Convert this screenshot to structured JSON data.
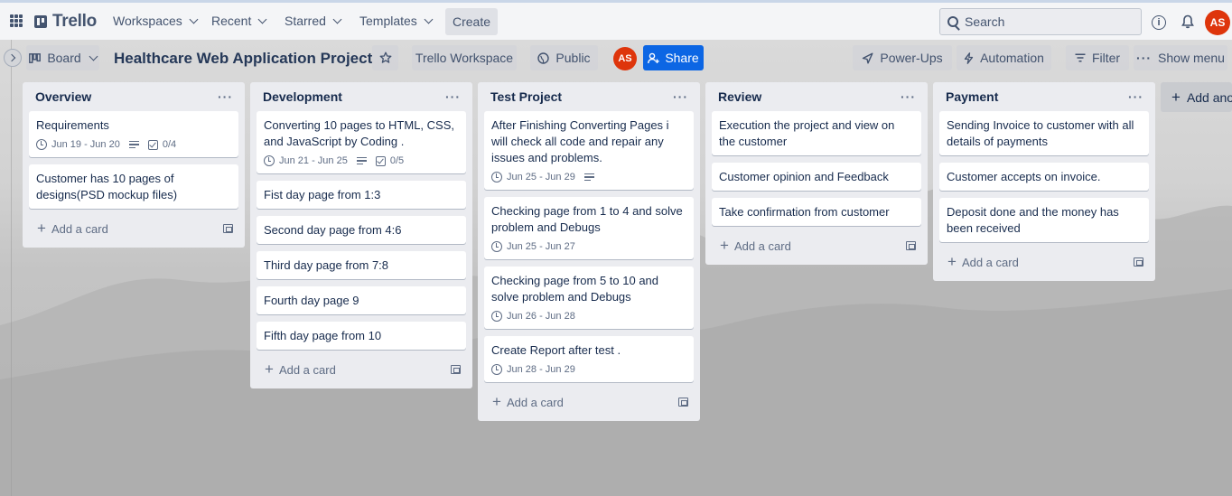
{
  "topbar": {
    "logo": "Trello",
    "nav": [
      {
        "label": "Workspaces"
      },
      {
        "label": "Recent"
      },
      {
        "label": "Starred"
      },
      {
        "label": "Templates"
      }
    ],
    "create": "Create",
    "search_placeholder": "Search",
    "avatar": "AS"
  },
  "board": {
    "view": "Board",
    "title": "Healthcare Web Application Project",
    "workspace": "Trello Workspace",
    "visibility": "Public",
    "member": "AS",
    "share": "Share",
    "powerups": "Power-Ups",
    "automation": "Automation",
    "filter": "Filter",
    "show_menu": "Show menu",
    "add_list": "Add another list"
  },
  "add_card_label": "Add a card",
  "lists": [
    {
      "title": "Overview",
      "cards": [
        {
          "title": "Requirements",
          "date": "Jun 19 - Jun 20",
          "desc": true,
          "checklist": "0/4"
        },
        {
          "title": "Customer has 10 pages of designs(PSD mockup files)"
        }
      ]
    },
    {
      "title": "Development",
      "cards": [
        {
          "title": "Converting 10 pages to HTML, CSS, and JavaScript by Coding .",
          "date": "Jun 21 - Jun 25",
          "desc": true,
          "checklist": "0/5"
        },
        {
          "title": "Fist day page from 1:3"
        },
        {
          "title": "Second day page from 4:6"
        },
        {
          "title": "Third day page from 7:8"
        },
        {
          "title": "Fourth day page 9"
        },
        {
          "title": "Fifth day page from 10"
        }
      ]
    },
    {
      "title": "Test Project",
      "cards": [
        {
          "title": "After Finishing Converting Pages i will check all code and repair any issues and problems.",
          "date": "Jun 25 - Jun 29",
          "desc": true
        },
        {
          "title": "Checking page from 1 to 4 and solve problem and Debugs",
          "date": "Jun 25 - Jun 27"
        },
        {
          "title": "Checking page from 5 to 10 and solve problem and Debugs",
          "date": "Jun 26 - Jun 28"
        },
        {
          "title": "Create Report after test .",
          "date": "Jun 28 - Jun 29"
        }
      ]
    },
    {
      "title": "Review",
      "cards": [
        {
          "title": "Execution the project and view on the customer"
        },
        {
          "title": "Customer opinion and Feedback"
        },
        {
          "title": "Take confirmation from customer"
        }
      ]
    },
    {
      "title": "Payment",
      "cards": [
        {
          "title": "Sending Invoice to customer with all details of payments"
        },
        {
          "title": "Customer accepts on invoice."
        },
        {
          "title": "Deposit done and the money has been received"
        }
      ]
    }
  ]
}
